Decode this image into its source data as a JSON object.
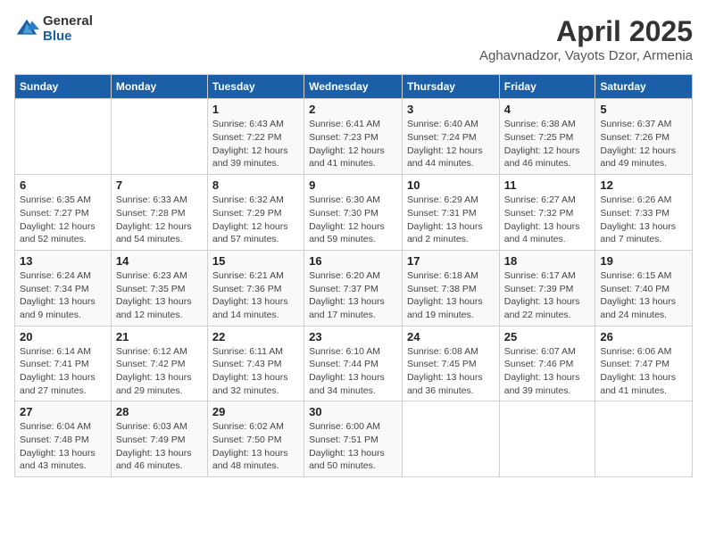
{
  "logo": {
    "general": "General",
    "blue": "Blue"
  },
  "title": "April 2025",
  "subtitle": "Aghavnadzor, Vayots Dzor, Armenia",
  "days_of_week": [
    "Sunday",
    "Monday",
    "Tuesday",
    "Wednesday",
    "Thursday",
    "Friday",
    "Saturday"
  ],
  "weeks": [
    [
      {
        "day": "",
        "info": ""
      },
      {
        "day": "",
        "info": ""
      },
      {
        "day": "1",
        "info": "Sunrise: 6:43 AM\nSunset: 7:22 PM\nDaylight: 12 hours and 39 minutes."
      },
      {
        "day": "2",
        "info": "Sunrise: 6:41 AM\nSunset: 7:23 PM\nDaylight: 12 hours and 41 minutes."
      },
      {
        "day": "3",
        "info": "Sunrise: 6:40 AM\nSunset: 7:24 PM\nDaylight: 12 hours and 44 minutes."
      },
      {
        "day": "4",
        "info": "Sunrise: 6:38 AM\nSunset: 7:25 PM\nDaylight: 12 hours and 46 minutes."
      },
      {
        "day": "5",
        "info": "Sunrise: 6:37 AM\nSunset: 7:26 PM\nDaylight: 12 hours and 49 minutes."
      }
    ],
    [
      {
        "day": "6",
        "info": "Sunrise: 6:35 AM\nSunset: 7:27 PM\nDaylight: 12 hours and 52 minutes."
      },
      {
        "day": "7",
        "info": "Sunrise: 6:33 AM\nSunset: 7:28 PM\nDaylight: 12 hours and 54 minutes."
      },
      {
        "day": "8",
        "info": "Sunrise: 6:32 AM\nSunset: 7:29 PM\nDaylight: 12 hours and 57 minutes."
      },
      {
        "day": "9",
        "info": "Sunrise: 6:30 AM\nSunset: 7:30 PM\nDaylight: 12 hours and 59 minutes."
      },
      {
        "day": "10",
        "info": "Sunrise: 6:29 AM\nSunset: 7:31 PM\nDaylight: 13 hours and 2 minutes."
      },
      {
        "day": "11",
        "info": "Sunrise: 6:27 AM\nSunset: 7:32 PM\nDaylight: 13 hours and 4 minutes."
      },
      {
        "day": "12",
        "info": "Sunrise: 6:26 AM\nSunset: 7:33 PM\nDaylight: 13 hours and 7 minutes."
      }
    ],
    [
      {
        "day": "13",
        "info": "Sunrise: 6:24 AM\nSunset: 7:34 PM\nDaylight: 13 hours and 9 minutes."
      },
      {
        "day": "14",
        "info": "Sunrise: 6:23 AM\nSunset: 7:35 PM\nDaylight: 13 hours and 12 minutes."
      },
      {
        "day": "15",
        "info": "Sunrise: 6:21 AM\nSunset: 7:36 PM\nDaylight: 13 hours and 14 minutes."
      },
      {
        "day": "16",
        "info": "Sunrise: 6:20 AM\nSunset: 7:37 PM\nDaylight: 13 hours and 17 minutes."
      },
      {
        "day": "17",
        "info": "Sunrise: 6:18 AM\nSunset: 7:38 PM\nDaylight: 13 hours and 19 minutes."
      },
      {
        "day": "18",
        "info": "Sunrise: 6:17 AM\nSunset: 7:39 PM\nDaylight: 13 hours and 22 minutes."
      },
      {
        "day": "19",
        "info": "Sunrise: 6:15 AM\nSunset: 7:40 PM\nDaylight: 13 hours and 24 minutes."
      }
    ],
    [
      {
        "day": "20",
        "info": "Sunrise: 6:14 AM\nSunset: 7:41 PM\nDaylight: 13 hours and 27 minutes."
      },
      {
        "day": "21",
        "info": "Sunrise: 6:12 AM\nSunset: 7:42 PM\nDaylight: 13 hours and 29 minutes."
      },
      {
        "day": "22",
        "info": "Sunrise: 6:11 AM\nSunset: 7:43 PM\nDaylight: 13 hours and 32 minutes."
      },
      {
        "day": "23",
        "info": "Sunrise: 6:10 AM\nSunset: 7:44 PM\nDaylight: 13 hours and 34 minutes."
      },
      {
        "day": "24",
        "info": "Sunrise: 6:08 AM\nSunset: 7:45 PM\nDaylight: 13 hours and 36 minutes."
      },
      {
        "day": "25",
        "info": "Sunrise: 6:07 AM\nSunset: 7:46 PM\nDaylight: 13 hours and 39 minutes."
      },
      {
        "day": "26",
        "info": "Sunrise: 6:06 AM\nSunset: 7:47 PM\nDaylight: 13 hours and 41 minutes."
      }
    ],
    [
      {
        "day": "27",
        "info": "Sunrise: 6:04 AM\nSunset: 7:48 PM\nDaylight: 13 hours and 43 minutes."
      },
      {
        "day": "28",
        "info": "Sunrise: 6:03 AM\nSunset: 7:49 PM\nDaylight: 13 hours and 46 minutes."
      },
      {
        "day": "29",
        "info": "Sunrise: 6:02 AM\nSunset: 7:50 PM\nDaylight: 13 hours and 48 minutes."
      },
      {
        "day": "30",
        "info": "Sunrise: 6:00 AM\nSunset: 7:51 PM\nDaylight: 13 hours and 50 minutes."
      },
      {
        "day": "",
        "info": ""
      },
      {
        "day": "",
        "info": ""
      },
      {
        "day": "",
        "info": ""
      }
    ]
  ]
}
